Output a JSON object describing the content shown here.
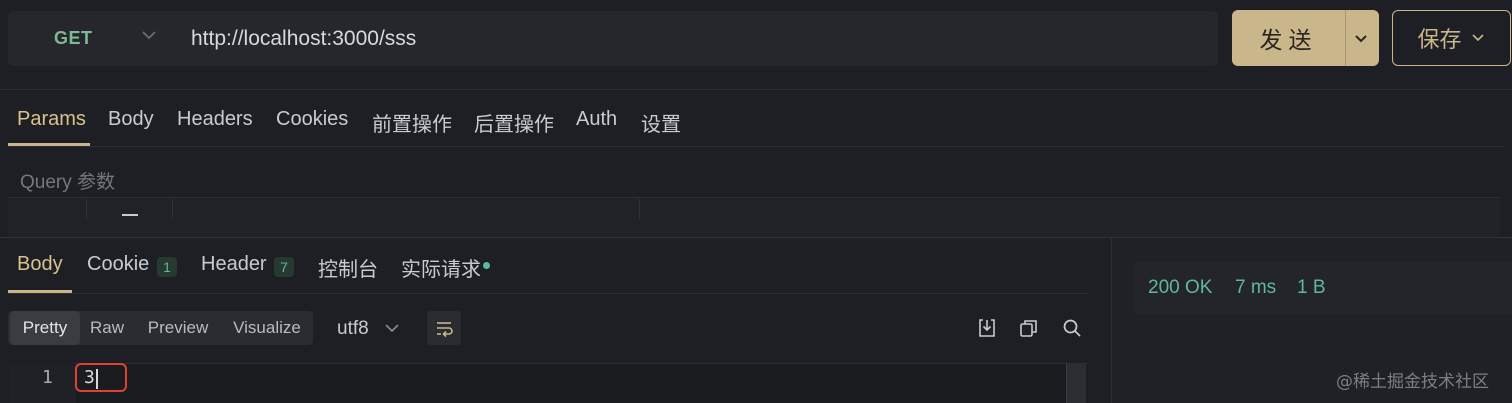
{
  "request": {
    "method": "GET",
    "url": "http://localhost:3000/sss",
    "send_label": "发送",
    "save_label": "保存"
  },
  "request_tabs": [
    "Params",
    "Body",
    "Headers",
    "Cookies",
    "前置操作",
    "后置操作",
    "Auth",
    "设置"
  ],
  "active_request_tab": "Params",
  "query_label": "Query 参数",
  "response_tabs": [
    {
      "label": "Body"
    },
    {
      "label": "Cookie",
      "count": "1"
    },
    {
      "label": "Header",
      "count": "7"
    },
    {
      "label": "控制台"
    },
    {
      "label": "实际请求"
    }
  ],
  "active_response_tab": "Body",
  "view_modes": [
    "Pretty",
    "Raw",
    "Preview",
    "Visualize"
  ],
  "active_view_mode": "Pretty",
  "encoding": "utf8",
  "status": {
    "code": "200 OK",
    "time": "7 ms",
    "size": "1 B"
  },
  "editor": {
    "line_number": "1",
    "content": "3"
  },
  "watermark": "@稀土掘金技术社区",
  "colors": {
    "accent": "#c9b68a",
    "success": "#5fb897",
    "method": "#7fb894",
    "highlight": "#e0422f"
  },
  "icons": [
    "chevron-down-icon",
    "download-icon",
    "copy-icon",
    "search-icon",
    "wrap-lines-icon"
  ]
}
